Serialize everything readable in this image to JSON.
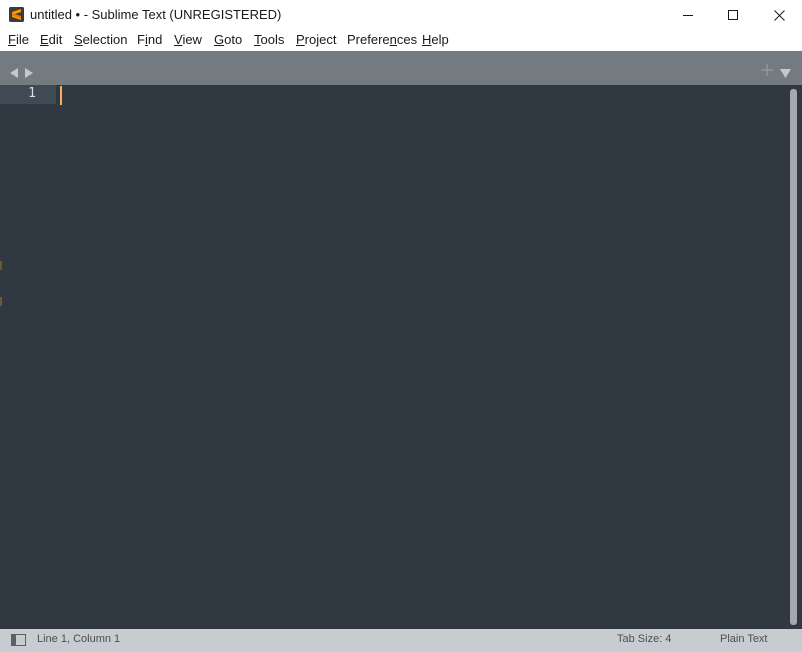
{
  "window": {
    "title": "untitled • - Sublime Text (UNREGISTERED)",
    "icon": "sublime-text-logo",
    "controls": [
      "minimize-icon",
      "maximize-icon",
      "close-icon"
    ]
  },
  "menu": {
    "items": [
      {
        "mnemonic": "F",
        "rest": "ile"
      },
      {
        "mnemonic": "E",
        "rest": "dit"
      },
      {
        "mnemonic": "S",
        "rest": "election"
      },
      {
        "pre": "F",
        "mnemonic": "i",
        "rest": "nd"
      },
      {
        "mnemonic": "V",
        "rest": "iew"
      },
      {
        "mnemonic": "G",
        "rest": "oto"
      },
      {
        "mnemonic": "T",
        "rest": "ools"
      },
      {
        "mnemonic": "P",
        "rest": "roject"
      },
      {
        "pre": "Prefere",
        "mnemonic": "n",
        "rest": "ces"
      },
      {
        "mnemonic": "H",
        "rest": "elp"
      }
    ]
  },
  "tabstrip": {
    "icons": [
      "chevron-left-icon",
      "chevron-right-icon",
      "plus-icon",
      "triangle-down-icon"
    ]
  },
  "editor": {
    "line_numbers": [
      "1"
    ],
    "content": "",
    "caret_color": "#f9ae58",
    "background": "#303841"
  },
  "status": {
    "position": "Line 1, Column 1",
    "tab_size": "Tab Size: 4",
    "syntax": "Plain Text"
  },
  "colors": {
    "tabstrip": "#737a80",
    "statusbar": "#c7ccd1",
    "gutter_active": "#3f4a55"
  }
}
